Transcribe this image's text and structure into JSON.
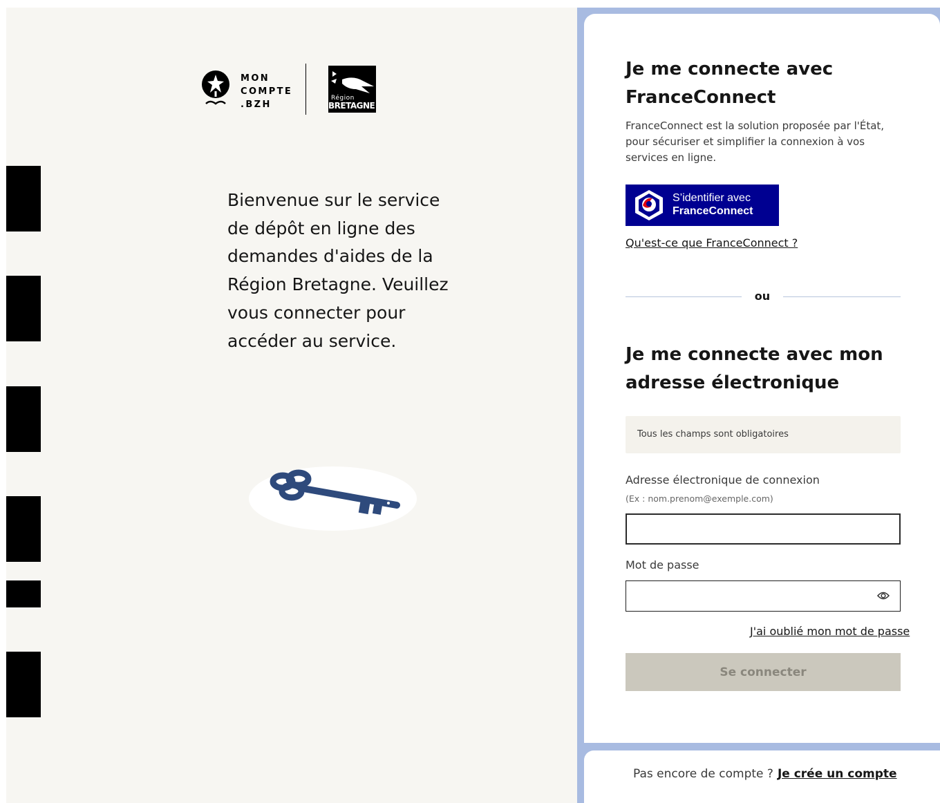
{
  "branding": {
    "mon_compte_lines": [
      "MON",
      "COMPTE",
      ".BZH"
    ],
    "region_small": "Région",
    "region_big": "BRETAGNE"
  },
  "welcome": {
    "text": "Bienvenue sur le service de dépôt en ligne des demandes d'aides de la Région Bretagne. Veuillez vous connecter pour accéder au service."
  },
  "franceconnect": {
    "title": "Je me connecte avec FranceConnect",
    "description": "FranceConnect est la solution proposée par l'État, pour sécuriser et simplifier la connexion à vos services en ligne.",
    "button_line1": "S’identifier avec",
    "button_line2": "FranceConnect",
    "button_color": "#000091",
    "info_link": "Qu'est-ce que FranceConnect ?"
  },
  "separator": {
    "text": "ou"
  },
  "email_login": {
    "title": "Je me connecte avec mon adresse électronique",
    "required_notice": "Tous les champs sont obligatoires",
    "email_label": "Adresse électronique de connexion",
    "email_hint": "(Ex : nom.prenom@exemple.com)",
    "email_value": "",
    "password_label": "Mot de passe",
    "password_value": "",
    "password_toggle_icon": "eye-icon",
    "forgot_link": "J'ai oublié mon mot de passe",
    "submit_label": "Se connecter"
  },
  "footer": {
    "prompt": "Pas encore de compte ?",
    "link": "Je crée un compte"
  },
  "colors": {
    "left_background": "#f7f6f2",
    "right_frame": "#a8bbe1",
    "submit_disabled": "#cbc8bd",
    "key": "#2e4a7c"
  }
}
